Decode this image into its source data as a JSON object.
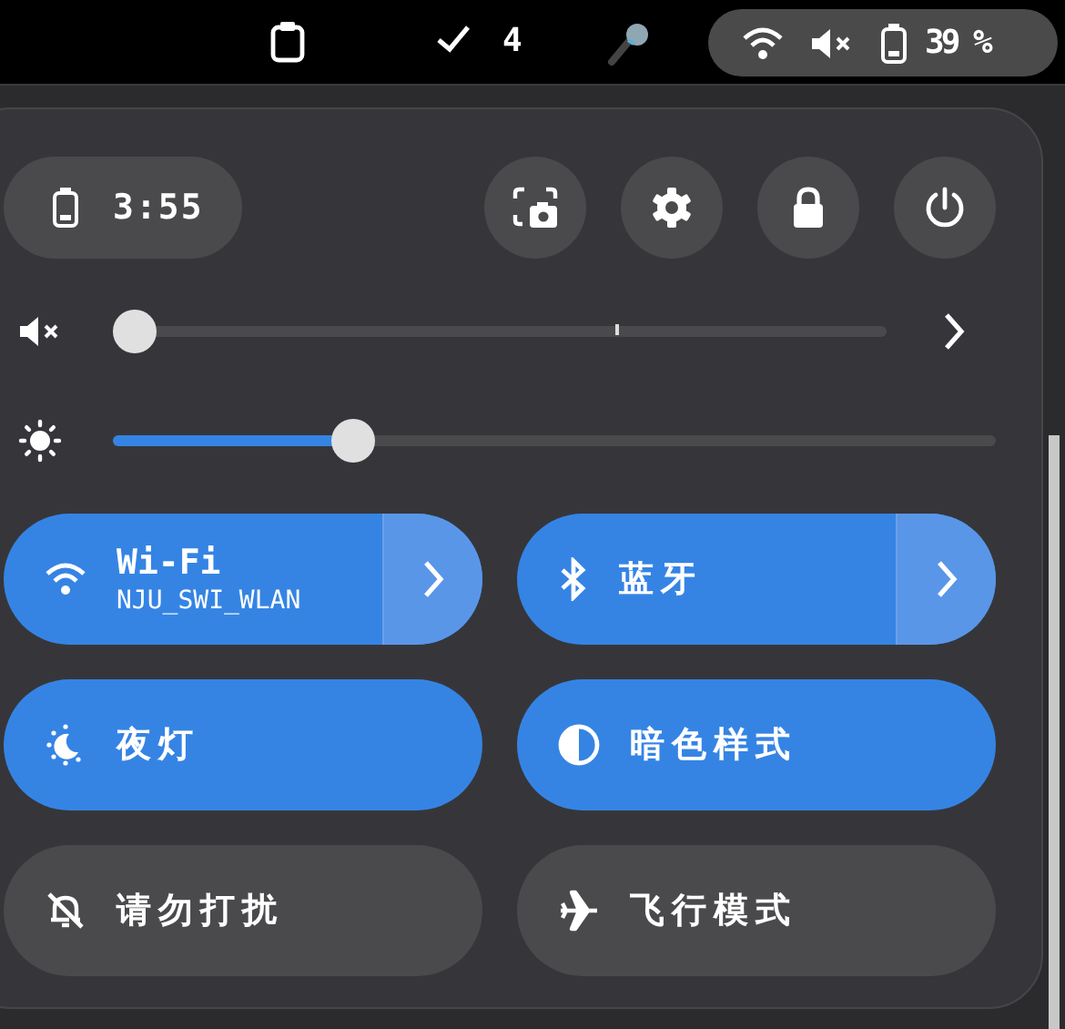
{
  "top_bar": {
    "task_count": "4",
    "battery_text": "39 %"
  },
  "panel": {
    "battery_time": "3:55",
    "sliders": [
      {
        "kind": "volume",
        "level": 0,
        "muted": true
      },
      {
        "kind": "brightness",
        "level": 0.26
      }
    ],
    "toggles": [
      {
        "kind": "menu",
        "label": "Wi-Fi",
        "subtitle": "NJU_SWI_WLAN",
        "checked": true
      },
      {
        "kind": "menu",
        "label": "蓝牙",
        "checked": true
      },
      {
        "kind": "plain",
        "label": "夜灯",
        "checked": true
      },
      {
        "kind": "plain",
        "label": "暗色样式",
        "checked": true
      },
      {
        "kind": "plain",
        "label": "请勿打扰",
        "checked": false
      },
      {
        "kind": "plain",
        "label": "飞行模式",
        "checked": false
      }
    ]
  }
}
